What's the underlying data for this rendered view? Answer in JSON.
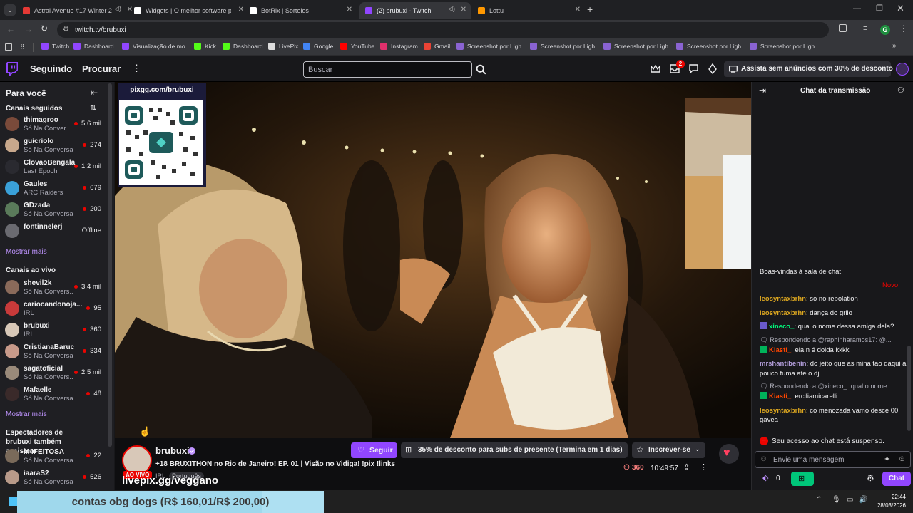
{
  "browser": {
    "tabs": [
      {
        "title": "Astral Avenue #17 Winter 2",
        "color": "#e53935",
        "audio": true
      },
      {
        "title": "Widgets | O melhor software p",
        "color": "#ffffff",
        "audio": false
      },
      {
        "title": "BotRix | Sorteios",
        "color": "#ffffff",
        "audio": false
      },
      {
        "title": "(2) brubuxi - Twitch",
        "color": "#9146ff",
        "audio": true,
        "active": true
      },
      {
        "title": "Lottu",
        "color": "#ff9800",
        "audio": false
      }
    ],
    "url": "twitch.tv/brubuxi",
    "profile_initial": "G",
    "bookmarks": [
      {
        "label": "Twitch",
        "color": "#9146ff"
      },
      {
        "label": "Dashboard",
        "color": "#9146ff"
      },
      {
        "label": "Visualização de mo...",
        "color": "#9146ff"
      },
      {
        "label": "Kick",
        "color": "#53fc18"
      },
      {
        "label": "Dashboard",
        "color": "#53fc18"
      },
      {
        "label": "LivePix",
        "color": "#dddddd"
      },
      {
        "label": "Google",
        "color": "#4285f4"
      },
      {
        "label": "YouTube",
        "color": "#ff0000"
      },
      {
        "label": "Instagram",
        "color": "#e1306c"
      },
      {
        "label": "Gmail",
        "color": "#ea4335"
      },
      {
        "label": "Screenshot por Ligh...",
        "color": "#8a63d2"
      },
      {
        "label": "Screenshot por Ligh...",
        "color": "#8a63d2"
      },
      {
        "label": "Screenshot por Ligh...",
        "color": "#8a63d2"
      },
      {
        "label": "Screenshot por Ligh...",
        "color": "#8a63d2"
      },
      {
        "label": "Screenshot por Ligh...",
        "color": "#8a63d2"
      }
    ]
  },
  "twitch": {
    "nav": {
      "following": "Seguindo",
      "browse": "Procurar"
    },
    "search_placeholder": "Buscar",
    "notif_count": "2",
    "promo": "Assista sem anúncios com 30% de desconto",
    "accent": "#9146ff",
    "sidebar": {
      "title": "Para você",
      "followed_title": "Canais seguidos",
      "followed": [
        {
          "name": "thimagroo",
          "game": "Só Na Conver...",
          "viewers": "5,6 mil",
          "color": "#7a4a3a"
        },
        {
          "name": "guicriolo",
          "game": "Só Na Conversa",
          "viewers": "274",
          "color": "#c8a88c"
        },
        {
          "name": "ClovaoBengala",
          "game": "Last Epoch",
          "viewers": "1,2 mil",
          "color": "#2a2a30"
        },
        {
          "name": "Gaules",
          "game": "ARC Raiders",
          "viewers": "679",
          "color": "#3aa0d8"
        },
        {
          "name": "GDzada",
          "game": "Só Na Conversa",
          "viewers": "200",
          "color": "#5a7a5a"
        },
        {
          "name": "fontinnelerj",
          "game": "",
          "viewers": "Offline",
          "color": "#6a6a70"
        }
      ],
      "show_more": "Mostrar mais",
      "live_title": "Canais ao vivo",
      "live": [
        {
          "name": "shevil2k",
          "game": "Só Na Convers...",
          "viewers": "3,4 mil",
          "color": "#8a6a5a"
        },
        {
          "name": "cariocandonoja...",
          "game": "IRL",
          "viewers": "95",
          "color": "#c83a3a"
        },
        {
          "name": "brubuxi",
          "game": "IRL",
          "viewers": "360",
          "color": "#d8c8b8"
        },
        {
          "name": "CristianaBaruc",
          "game": "Só Na Conversa",
          "viewers": "334",
          "color": "#c89a8a"
        },
        {
          "name": "sagatoficial",
          "game": "Só Na Convers...",
          "viewers": "2,5 mil",
          "color": "#9a8a7a"
        },
        {
          "name": "Mafaelle",
          "game": "Só Na Conversa",
          "viewers": "48",
          "color": "#3a2a2a"
        }
      ],
      "show_more2": "Mostrar mais",
      "also_title": "Espectadores de brubuxi também assistem",
      "also": [
        {
          "name": "M4FEITOSA",
          "game": "Só Na Conversa",
          "viewers": "22",
          "color": "#7a6a5a"
        },
        {
          "name": "iaaraS2",
          "game": "Só Na Conversa",
          "viewers": "526",
          "color": "#b89a8a"
        }
      ]
    },
    "overlay": {
      "pix_label": "pixgg.com/brubuxi",
      "livepix_label": "livepix.gg/veggano"
    },
    "stream": {
      "channel": "brubuxi",
      "live_badge": "AO VIVO",
      "title": "+18 BRUXITHON no Rio de Janeiro! EP. 01 | Visão no Vidiga! !pix !links",
      "tags": [
        "IRL",
        "Português"
      ],
      "follow": "Seguir",
      "gift": "35% de desconto para subs de presente (Termina em 1 dias)",
      "subscribe": "Inscrever-se",
      "viewers": "360",
      "uptime": "10:49:57"
    },
    "chat": {
      "header": "Chat da transmissão",
      "welcome": "Boas-vindas à sala de chat!",
      "new_label": "Novo",
      "messages": [
        {
          "user": "leosyntaxbrhn",
          "color": "#daa520",
          "text": "so no rebolation"
        },
        {
          "user": "leosyntaxbrhn",
          "color": "#daa520",
          "text": "dança do grilo"
        },
        {
          "user": "xineco_",
          "color": "#00ff7f",
          "text": "qual o nome dessa amiga dela?"
        },
        {
          "reply": "Respondendo a @raphinharamos17: @...",
          "user": "Kiasti_",
          "color": "#ff4500",
          "text": "ela n é doida kkkk"
        },
        {
          "user": "mrshantibenin",
          "color": "#b19cd9",
          "text": "do jeito que as mina tao daqui a pouco fuma ate o dj"
        },
        {
          "reply": "Respondendo a @xineco_: qual o nome...",
          "user": "Kiasti_",
          "color": "#ff4500",
          "text": "erciliamicarelli"
        },
        {
          "user": "leosyntaxbrhn",
          "color": "#daa520",
          "text": "co menozada vamo desce 00 gavea"
        }
      ],
      "suspended": "Seu acesso ao chat está suspenso.",
      "input_placeholder": "Envie uma mensagem",
      "points": "0",
      "chat_button": "Chat"
    }
  },
  "donation": {
    "text": "contas obg dogs (R$ 160,01/R$ 200,00)",
    "progress": 0.8
  },
  "taskbar": {
    "time": "22:44",
    "date": "28/03/2026"
  }
}
